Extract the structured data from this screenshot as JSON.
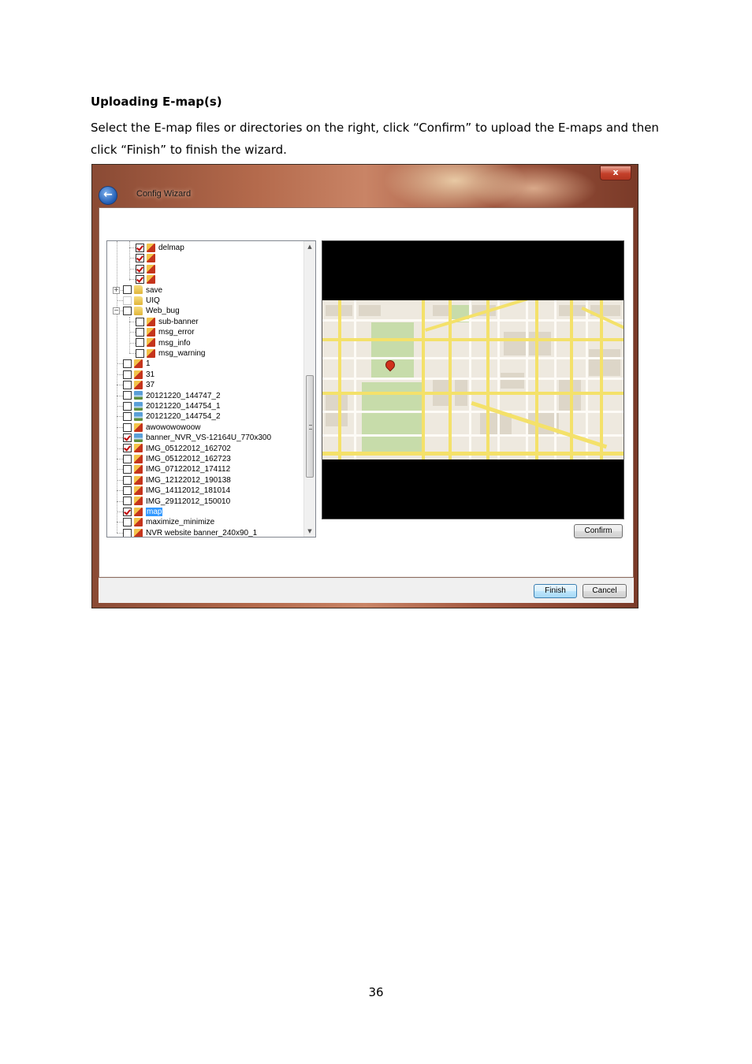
{
  "heading": "Uploading E-map(s)",
  "paragraph": "Select the E-map files or directories on the right, click “Confirm” to upload the E-maps and then click “Finish” to finish the wizard.",
  "page_number": "36",
  "window": {
    "title": "Config Wizard",
    "close_glyph": "x",
    "back_glyph": "←"
  },
  "tree": {
    "items": [
      {
        "label": "delmap",
        "checked": true,
        "icon": "image-file-icon"
      },
      {
        "label": "",
        "checked": true,
        "icon": "image-file-icon"
      },
      {
        "label": "",
        "checked": true,
        "icon": "image-file-icon"
      },
      {
        "label": "",
        "checked": true,
        "icon": "image-file-icon"
      },
      {
        "label": "save",
        "checked": false,
        "icon": "folder-icon"
      },
      {
        "label": "UIQ",
        "checked": false,
        "icon": "folder-icon"
      },
      {
        "label": "Web_bug",
        "checked": false,
        "icon": "folder-icon"
      },
      {
        "label": "sub-banner",
        "checked": false,
        "icon": "image-file-icon"
      },
      {
        "label": "msg_error",
        "checked": false,
        "icon": "image-file-icon"
      },
      {
        "label": "msg_info",
        "checked": false,
        "icon": "image-file-icon"
      },
      {
        "label": "msg_warning",
        "checked": false,
        "icon": "image-file-icon"
      },
      {
        "label": "1",
        "checked": false,
        "icon": "image-file-icon"
      },
      {
        "label": "31",
        "checked": false,
        "icon": "image-file-icon"
      },
      {
        "label": "37",
        "checked": false,
        "icon": "image-file-icon"
      },
      {
        "label": "20121220_144747_2",
        "checked": false,
        "icon": "photo-file-icon"
      },
      {
        "label": "20121220_144754_1",
        "checked": false,
        "icon": "photo-file-icon"
      },
      {
        "label": "20121220_144754_2",
        "checked": false,
        "icon": "photo-file-icon"
      },
      {
        "label": "awowowowoow",
        "checked": false,
        "icon": "image-file-icon"
      },
      {
        "label": "banner_NVR_VS-12164U_770x300",
        "checked": true,
        "icon": "photo-file-icon"
      },
      {
        "label": "IMG_05122012_162702",
        "checked": true,
        "icon": "image-file-icon"
      },
      {
        "label": "IMG_05122012_162723",
        "checked": false,
        "icon": "image-file-icon"
      },
      {
        "label": "IMG_07122012_174112",
        "checked": false,
        "icon": "image-file-icon"
      },
      {
        "label": "IMG_12122012_190138",
        "checked": false,
        "icon": "image-file-icon"
      },
      {
        "label": "IMG_14112012_181014",
        "checked": false,
        "icon": "image-file-icon"
      },
      {
        "label": "IMG_29112012_150010",
        "checked": false,
        "icon": "image-file-icon"
      },
      {
        "label": "map",
        "checked": true,
        "icon": "image-file-icon",
        "selected": true
      },
      {
        "label": "maximize_minimize",
        "checked": false,
        "icon": "image-file-icon"
      },
      {
        "label": "NVR website banner_240x90_1",
        "checked": false,
        "icon": "image-file-icon"
      }
    ]
  },
  "buttons": {
    "confirm": "Confirm",
    "finish": "Finish",
    "cancel": "Cancel"
  },
  "colors": {
    "selection": "#3399ff",
    "check": "#c00000",
    "park": "#c7dcaa",
    "major_road": "#f4e16a"
  }
}
